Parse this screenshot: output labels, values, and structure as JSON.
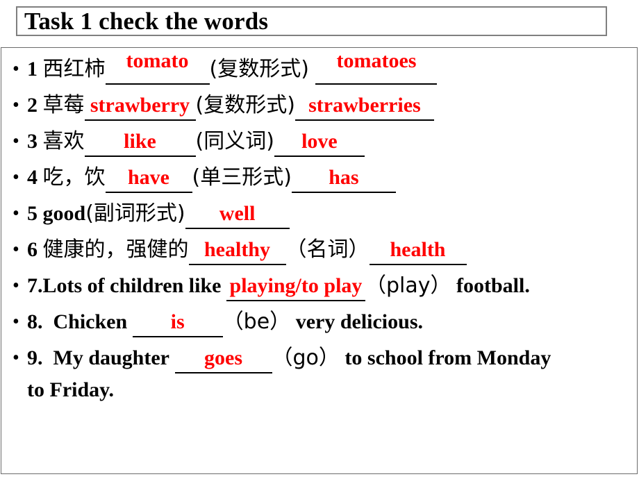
{
  "slide": {
    "title": "Task 1 check the words",
    "accent_red": "#ff0000",
    "text_black": "#000000",
    "title_border": "#7f7f7f",
    "content_border": "#6b6b6b"
  },
  "items": [
    {
      "bullet": "•",
      "number": "1",
      "prompt_cn": "西红柿",
      "answer1": "tomato",
      "hint": "(复数形式)",
      "answer2": "tomatoes"
    },
    {
      "bullet": "•",
      "number": "2",
      "prompt_cn": "草莓",
      "answer1": "strawberry",
      "hint": "(复数形式)",
      "answer2": "strawberries"
    },
    {
      "bullet": "•",
      "number": "3",
      "prompt_cn": "喜欢",
      "answer1": "like",
      "hint": "(同义词)",
      "answer2": "love"
    },
    {
      "bullet": "•",
      "number": "4",
      "prompt_cn": "吃，饮",
      "answer1": "have",
      "hint": "(单三形式)",
      "answer2": "has"
    },
    {
      "bullet": "•",
      "number": "5",
      "prompt_en": "good",
      "hint": "(副词形式)",
      "answer2": "well"
    },
    {
      "bullet": "•",
      "number": "6",
      "prompt_cn": "健康的，强健的",
      "answer1": "healthy",
      "hint": "（名词）",
      "answer2": "health"
    },
    {
      "bullet": "•",
      "number": "7.",
      "sentence_before": "Lots of children like",
      "answer": "playing/to play",
      "cue": "（play）",
      "sentence_after": "football."
    },
    {
      "bullet": "•",
      "number": "8.",
      "sentence_before": "Chicken",
      "answer": "is",
      "cue": "（be）",
      "sentence_after": "very delicious."
    },
    {
      "bullet": "•",
      "number": "9.",
      "sentence_before": "My daughter",
      "answer": "goes",
      "cue": "（go）",
      "sentence_after": "to school from Monday",
      "sentence_wrap": "to Friday."
    }
  ]
}
